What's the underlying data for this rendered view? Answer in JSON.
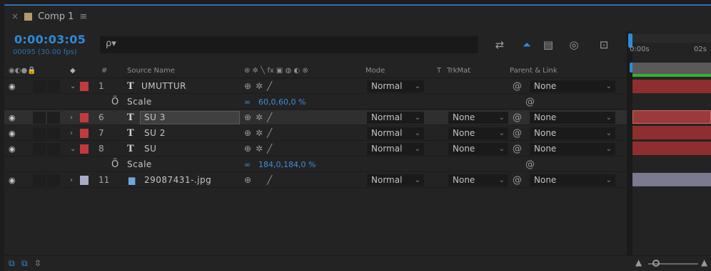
{
  "tab": {
    "close": "×",
    "title": "Comp 1",
    "menu": "≡"
  },
  "timecode": "0:00:03:05",
  "frames": "00095 (30.00 fps)",
  "search": {
    "placeholder": "ρ▾"
  },
  "ruler": {
    "t0": "0:00s",
    "t1": "02s"
  },
  "headers": {
    "av": "◉◐●🔒",
    "label": "◆",
    "num": "#",
    "source": "Source Name",
    "switches": "⊕ ✲ ╲ fx ▣ ◍ ◐ ⊗",
    "mode": "Mode",
    "t": "T",
    "trkmat": "TrkMat",
    "parent": "Parent & Link"
  },
  "layers": [
    {
      "num": "1",
      "name": "UMUTTUR",
      "type": "T",
      "expanded": true,
      "mode": "Normal",
      "trkmat": "",
      "parent": "None",
      "color": "#c23a3a",
      "selected": false
    },
    {
      "num": "6",
      "name": "SU 3",
      "type": "T",
      "expanded": false,
      "mode": "Normal",
      "trkmat": "None",
      "parent": "None",
      "color": "#c23a3a",
      "selected": true
    },
    {
      "num": "7",
      "name": "SU 2",
      "type": "T",
      "expanded": false,
      "mode": "Normal",
      "trkmat": "None",
      "parent": "None",
      "color": "#c23a3a",
      "selected": false
    },
    {
      "num": "8",
      "name": "SU",
      "type": "T",
      "expanded": true,
      "mode": "Normal",
      "trkmat": "None",
      "parent": "None",
      "color": "#c23a3a",
      "selected": false
    },
    {
      "num": "11",
      "name": "29087431-.jpg",
      "type": "img",
      "expanded": false,
      "mode": "Normal",
      "trkmat": "None",
      "parent": "None",
      "color": "#a9a9c9",
      "selected": false
    }
  ],
  "props": [
    {
      "name": "Scale",
      "value": "60,0,60,0 %"
    },
    {
      "name": "Scale",
      "value": "184,0,184,0 %"
    }
  ],
  "colors": {
    "accent": "#2e8bd8",
    "layer_red": "#c23a3a",
    "layer_lavender": "#a9a9c9",
    "bar_red": "#8f2e2e",
    "bar_gray": "#7c7a8f"
  }
}
